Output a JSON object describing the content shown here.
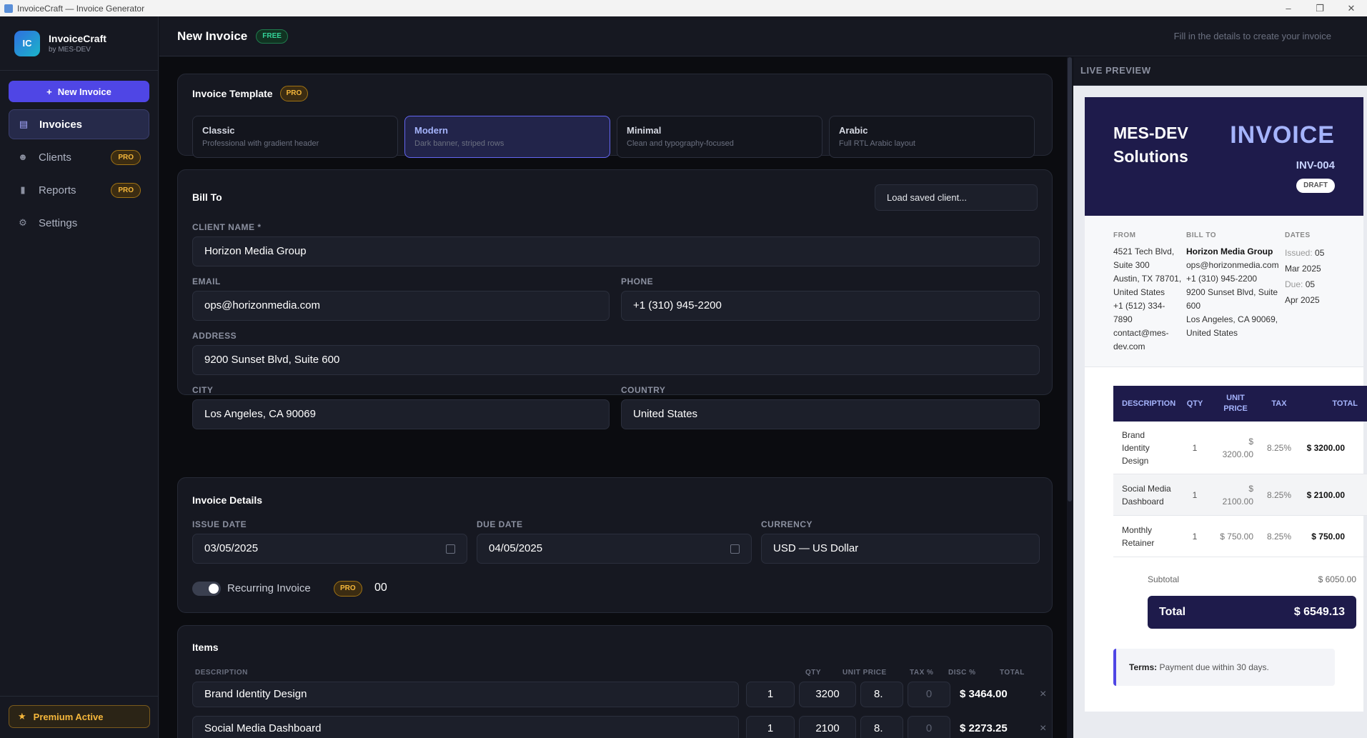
{
  "window": {
    "title": "InvoiceCraft — Invoice Generator"
  },
  "brand": {
    "logo": "IC",
    "name": "InvoiceCraft",
    "by": "by MES-DEV"
  },
  "sidebar": {
    "new_invoice": "New Invoice",
    "items": [
      {
        "label": "Invoices",
        "icon": "document-icon",
        "active": true
      },
      {
        "label": "Clients",
        "icon": "users-icon",
        "badge": "PRO"
      },
      {
        "label": "Reports",
        "icon": "bar-chart-icon",
        "badge": "PRO"
      },
      {
        "label": "Settings",
        "icon": "gear-icon"
      }
    ],
    "premium": "Premium Active"
  },
  "header": {
    "title": "New Invoice",
    "badge": "FREE",
    "hint": "Fill in the details to create your invoice"
  },
  "template": {
    "title": "Invoice Template",
    "badge": "PRO",
    "options": [
      {
        "name": "Classic",
        "desc": "Professional with gradient header"
      },
      {
        "name": "Modern",
        "desc": "Dark banner, striped rows",
        "selected": true
      },
      {
        "name": "Minimal",
        "desc": "Clean and typography-focused"
      },
      {
        "name": "Arabic",
        "desc": "Full RTL Arabic layout"
      }
    ]
  },
  "bill_to": {
    "title": "Bill To",
    "load_saved": "Load saved client...",
    "client_name_label": "CLIENT NAME *",
    "client_name": "Horizon Media Group",
    "email_label": "EMAIL",
    "email": "ops@horizonmedia.com",
    "phone_label": "PHONE",
    "phone": "+1 (310) 945-2200",
    "address_label": "ADDRESS",
    "address": "9200 Sunset Blvd, Suite 600",
    "city_label": "CITY",
    "city": "Los Angeles, CA 90069",
    "country_label": "COUNTRY",
    "country": "United States"
  },
  "details": {
    "title": "Invoice Details",
    "issue_label": "ISSUE DATE",
    "issue": "03/05/2025",
    "due_label": "DUE DATE",
    "due": "04/05/2025",
    "currency_label": "CURRENCY",
    "currency": "USD — US Dollar",
    "recurring_label": "Recurring Invoice",
    "recurring_badge": "PRO",
    "recurring_value": "00"
  },
  "items": {
    "title": "Items",
    "headers": {
      "description": "DESCRIPTION",
      "qty": "QTY",
      "unit_price": "UNIT PRICE",
      "tax": "TAX %",
      "disc": "DISC %",
      "total": "TOTAL"
    },
    "rows": [
      {
        "description": "Brand Identity Design",
        "qty": "1",
        "unit_price": "3200",
        "tax": "8.",
        "disc": "0",
        "total": "$ 3464.00"
      },
      {
        "description": "Social Media Dashboard",
        "qty": "1",
        "unit_price": "2100",
        "tax": "8.",
        "disc": "0",
        "total": "$ 2273.25"
      }
    ]
  },
  "preview": {
    "header": "LIVE PREVIEW",
    "company": "MES-DEV Solutions",
    "invoice_word": "INVOICE",
    "number": "INV-004",
    "status": "DRAFT",
    "from_label": "FROM",
    "from": [
      "4521 Tech Blvd,",
      "Suite 300",
      "Austin, TX 78701,",
      "United States",
      "+1 (512) 334-",
      "7890",
      "contact@mes-",
      "dev.com"
    ],
    "billto_label": "BILL TO",
    "billto_name": "Horizon Media Group",
    "billto": [
      "ops@horizonmedia.com",
      "+1 (310) 945-2200",
      "9200 Sunset Blvd, Suite",
      "600",
      "Los Angeles, CA 90069,",
      "United States"
    ],
    "dates_label": "DATES",
    "issued_label": "Issued:",
    "issued": "05",
    "issued_2": "Mar 2025",
    "due_label": "Due:",
    "due": "05",
    "due_2": "Apr 2025",
    "table_headers": {
      "description": "DESCRIPTION",
      "qty": "QTY",
      "unit_price": "UNIT PRICE",
      "tax": "TAX",
      "total": "TOTAL"
    },
    "rows": [
      {
        "description": "Brand Identity Design",
        "qty": "1",
        "unit_price": "$ 3200.00",
        "tax": "8.25%",
        "total": "$ 3200.00"
      },
      {
        "description": "Social Media Dashboard",
        "qty": "1",
        "unit_price": "$ 2100.00",
        "tax": "8.25%",
        "total": "$ 2100.00"
      },
      {
        "description": "Monthly Retainer",
        "qty": "1",
        "unit_price": "$ 750.00",
        "tax": "8.25%",
        "total": "$ 750.00"
      }
    ],
    "subtotal_label": "Subtotal",
    "subtotal": "$ 6050.00",
    "total_label": "Total",
    "total": "$ 6549.13",
    "terms_label": "Terms:",
    "terms": "Payment due within 30 days."
  }
}
